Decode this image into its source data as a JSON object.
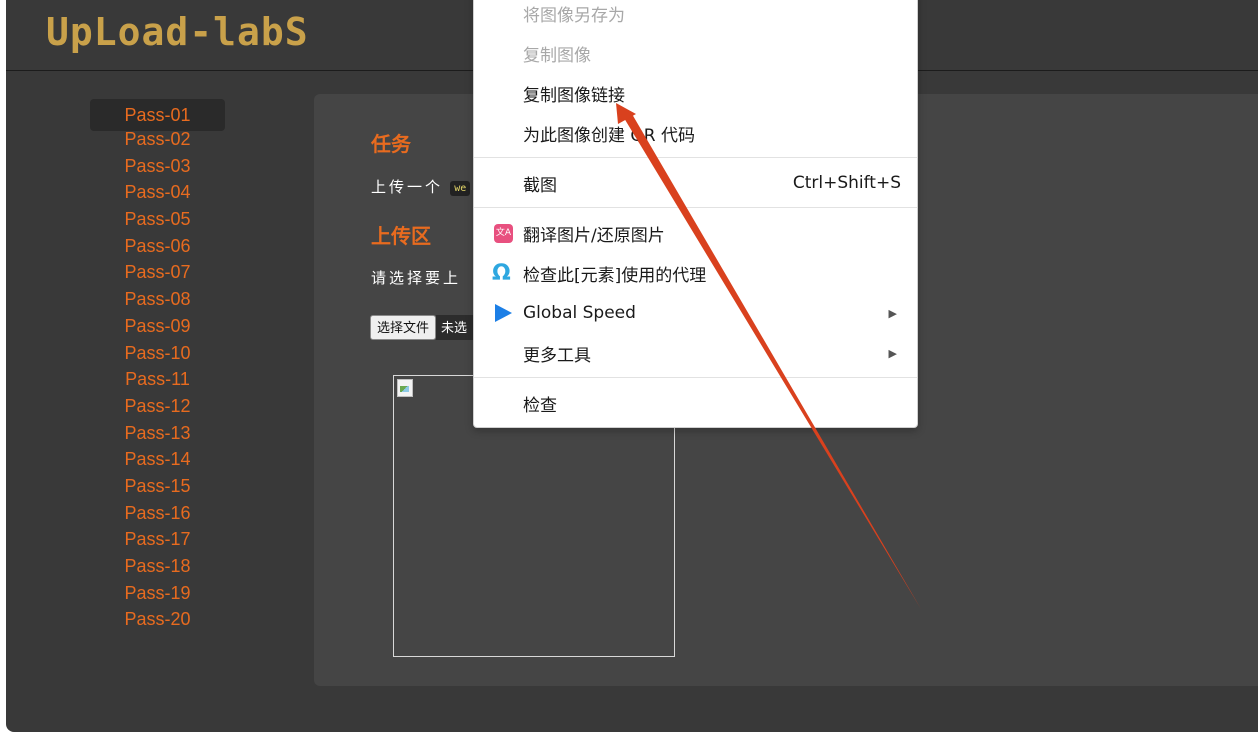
{
  "header": {
    "logo_text": "UpLoad-labS"
  },
  "sidebar": {
    "items": [
      "Pass-01",
      "Pass-02",
      "Pass-03",
      "Pass-04",
      "Pass-05",
      "Pass-06",
      "Pass-07",
      "Pass-08",
      "Pass-09",
      "Pass-10",
      "Pass-11",
      "Pass-12",
      "Pass-13",
      "Pass-14",
      "Pass-15",
      "Pass-16",
      "Pass-17",
      "Pass-18",
      "Pass-19",
      "Pass-20"
    ],
    "active_index": 0
  },
  "main": {
    "task_title": "任务",
    "task_text": "上传一个",
    "task_code": "we",
    "upload_title": "上传区",
    "upload_prompt": "请选择要上",
    "file_button": "选择文件",
    "file_status": "未选"
  },
  "context_menu": {
    "items": {
      "save_image_as": "将图像另存为",
      "copy_image": "复制图像",
      "copy_image_link": "复制图像链接",
      "create_qr": "为此图像创建 QR 代码",
      "screenshot": "截图",
      "screenshot_shortcut": "Ctrl+Shift+S",
      "translate_image": "翻译图片/还原图片",
      "inspect_proxy": "检查此[元素]使用的代理",
      "global_speed": "Global Speed",
      "more_tools": "更多工具",
      "inspect": "检查"
    },
    "icons": {
      "translate": "translate-icon",
      "omega": "omega-proxy-icon",
      "speed": "play-icon",
      "submenu": "chevron-right-icon"
    }
  },
  "annotation": {
    "arrow_color": "#d9411e"
  },
  "colors": {
    "accent": "#e86b1f",
    "logo": "#c9a14a",
    "background": "#393939",
    "panel": "#454545"
  }
}
